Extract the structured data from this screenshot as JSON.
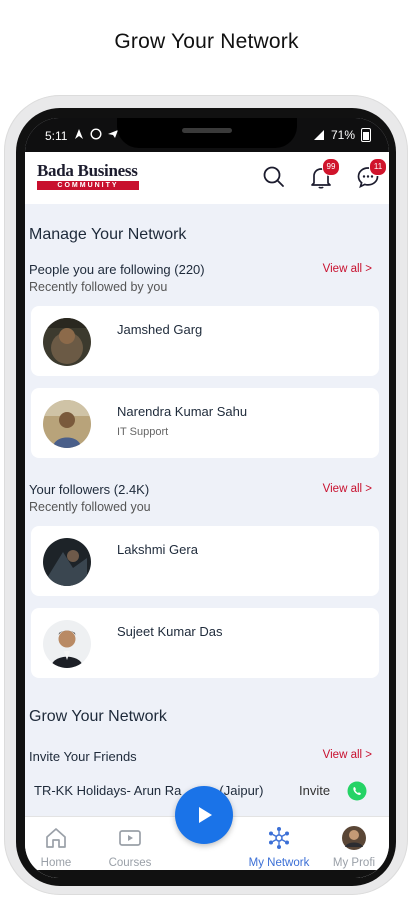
{
  "headline": "Grow Your Network",
  "status": {
    "time": "5:11",
    "battery": "71%"
  },
  "brand": {
    "name_top": "Bada Business",
    "name_bottom": "COMMUNITY",
    "color": "#c8102e"
  },
  "header": {
    "notifications_badge": "99",
    "messages_badge": "11"
  },
  "manage": {
    "title": "Manage Your Network",
    "following": {
      "label": "People you are following (220)",
      "caption": "Recently followed by you",
      "view_all": "View all >",
      "people": [
        {
          "name": "Jamshed Garg",
          "role": ""
        },
        {
          "name": "Narendra Kumar  Sahu",
          "role": "IT Support"
        }
      ]
    },
    "followers": {
      "label": "Your followers (2.4K)",
      "caption": "Recently followed you",
      "view_all": "View all >",
      "people": [
        {
          "name": "Lakshmi Gera",
          "role": ""
        },
        {
          "name": "Sujeet Kumar Das",
          "role": ""
        }
      ]
    }
  },
  "grow": {
    "title": "Grow Your Network",
    "invite_label": "Invite Your Friends",
    "view_all": "View all >",
    "contact": "TR-KK Holidays- Arun Ra",
    "contact_suffix": "(Jaipur)",
    "invite": "Invite"
  },
  "nav": {
    "items": [
      "Home",
      "Courses",
      "My Network",
      "My Profi"
    ],
    "active": "My Network",
    "accent": "#3b6fd6"
  }
}
